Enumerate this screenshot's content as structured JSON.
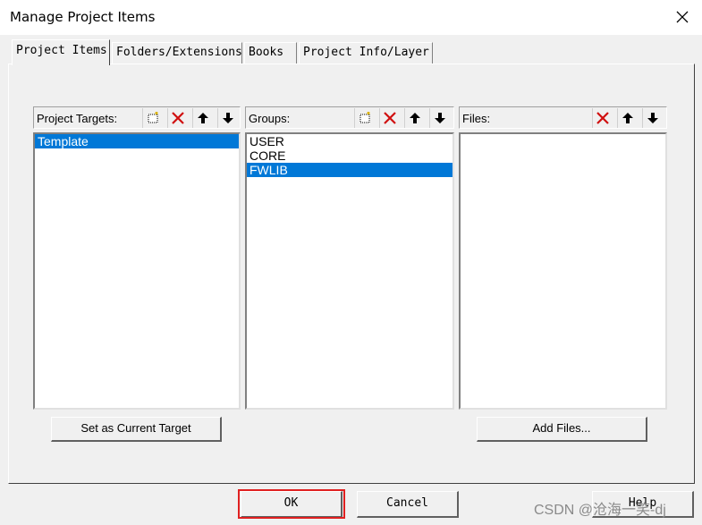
{
  "window": {
    "title": "Manage Project Items"
  },
  "tabs": [
    {
      "label": "Project Items",
      "active": true
    },
    {
      "label": "Folders/Extensions",
      "active": false
    },
    {
      "label": "Books",
      "active": false
    },
    {
      "label": "Project Info/Layer",
      "active": false
    }
  ],
  "targets": {
    "label": "Project Targets:",
    "items": [
      "Template"
    ],
    "selected": "Template"
  },
  "groups": {
    "label": "Groups:",
    "items": [
      "USER",
      "CORE",
      "FWLIB"
    ],
    "selected": "FWLIB"
  },
  "files": {
    "label": "Files:",
    "items": []
  },
  "buttons": {
    "set_current": "Set as Current Target",
    "add_files": "Add Files...",
    "ok": "OK",
    "cancel": "Cancel",
    "help": "Help"
  },
  "watermark": "CSDN @沧海一笑-dj",
  "icons": {
    "new": "new-item-icon",
    "delete": "delete-icon",
    "up": "move-up-icon",
    "down": "move-down-icon"
  },
  "colors": {
    "selection": "#0078d7",
    "highlight_box": "#e02020"
  }
}
